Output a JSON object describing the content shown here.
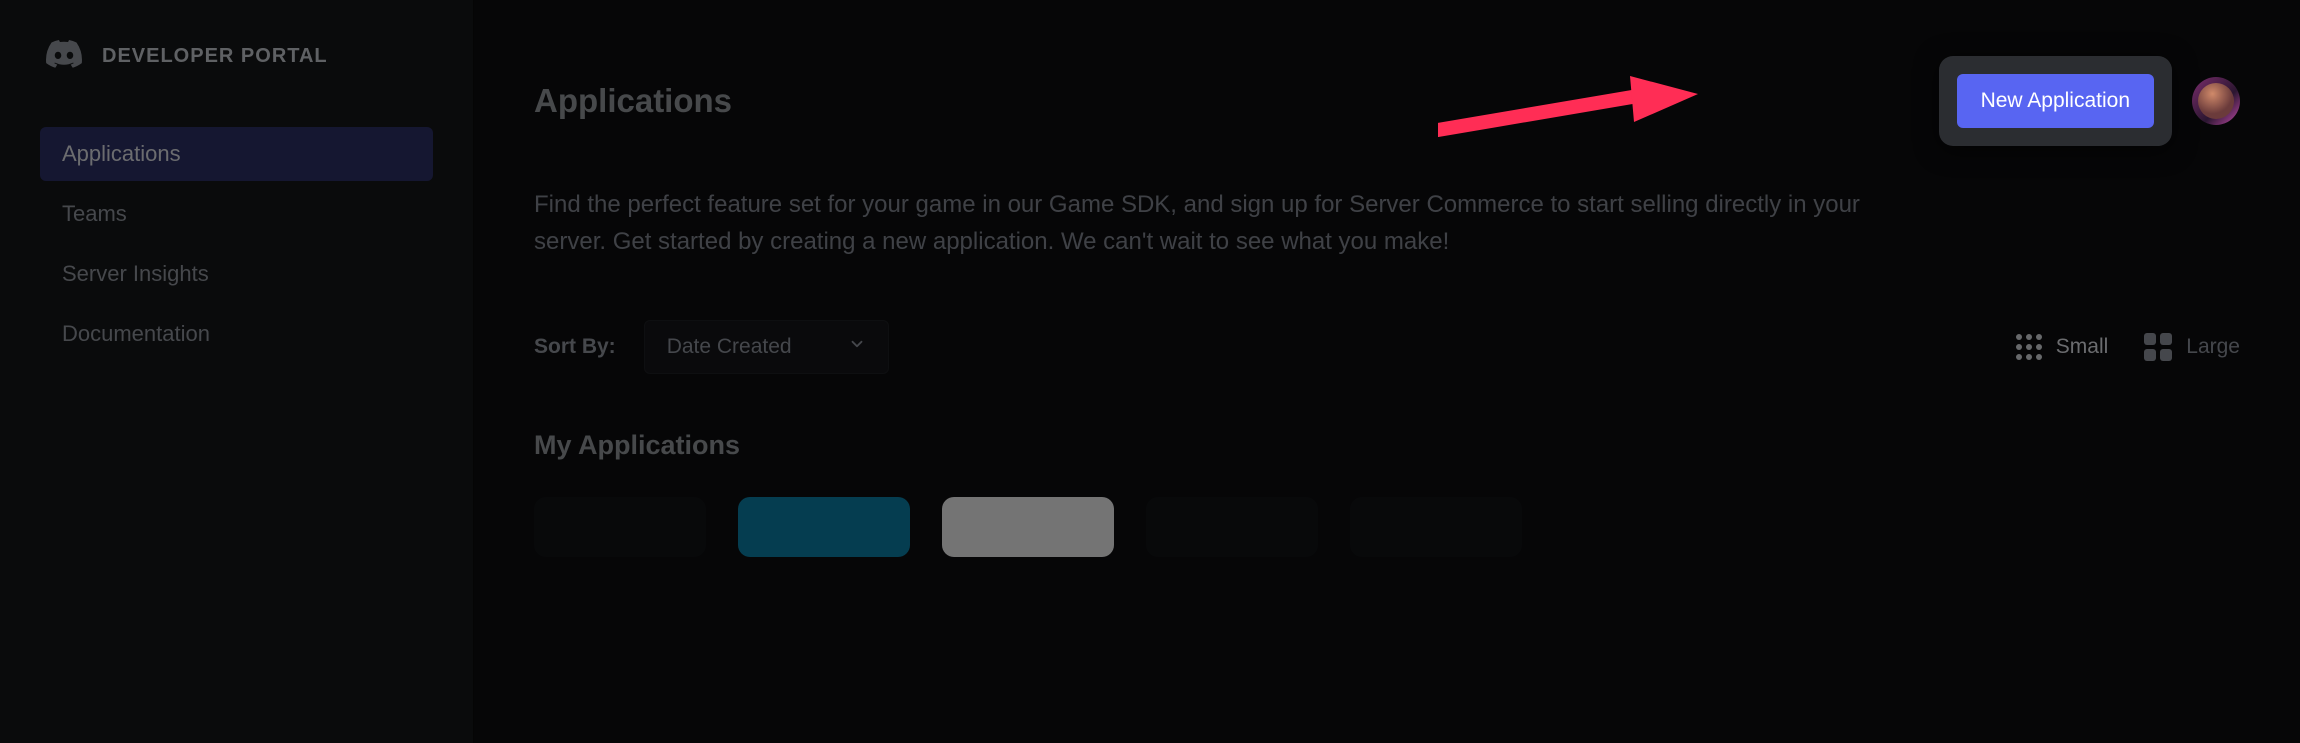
{
  "brand": {
    "title": "DEVELOPER PORTAL"
  },
  "sidebar": {
    "items": [
      {
        "label": "Applications",
        "active": true
      },
      {
        "label": "Teams",
        "active": false
      },
      {
        "label": "Server Insights",
        "active": false
      },
      {
        "label": "Documentation",
        "active": false
      }
    ]
  },
  "header": {
    "title": "Applications",
    "new_app_label": "New Application"
  },
  "description": "Find the perfect feature set for your game in our Game SDK, and sign up for Server Commerce to start selling directly in your server. Get started by creating a new application. We can't wait to see what you make!",
  "sort": {
    "label": "Sort By:",
    "selected": "Date Created"
  },
  "view": {
    "small_label": "Small",
    "large_label": "Large",
    "active": "small"
  },
  "section": {
    "title": "My Applications"
  },
  "annotation": {
    "arrow_color": "#ff2d55"
  }
}
